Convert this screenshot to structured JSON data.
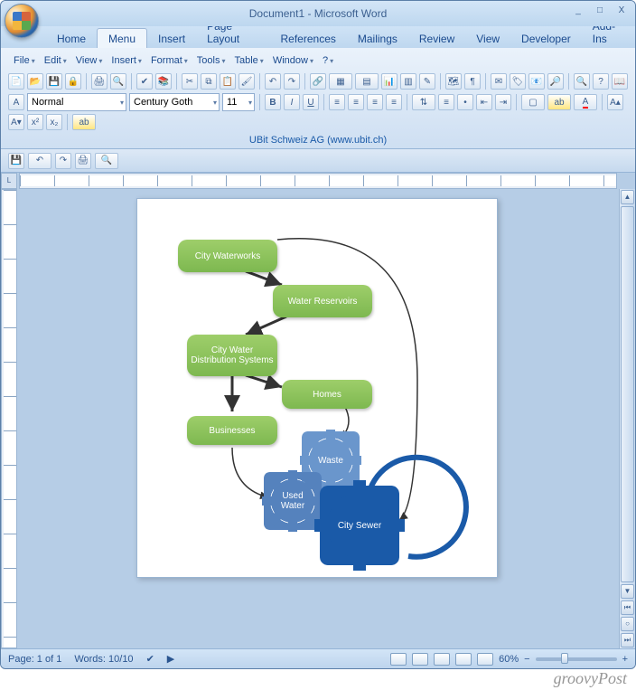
{
  "window": {
    "title": "Document1 - Microsoft Word",
    "min": "_",
    "max": "□",
    "close": "X"
  },
  "tabs": {
    "items": [
      "Home",
      "Menu",
      "Insert",
      "Page Layout",
      "References",
      "Mailings",
      "Review",
      "View",
      "Developer",
      "Add-Ins"
    ],
    "active_index": 1
  },
  "menubar": {
    "items": [
      "File",
      "Edit",
      "View",
      "Insert",
      "Format",
      "Tools",
      "Table",
      "Window",
      "?"
    ]
  },
  "style_combo": "Normal",
  "font_combo": "Century Goth",
  "size_combo": "11",
  "ribbon_footer": {
    "text": "UBit Schweiz AG (www.ubit.ch)"
  },
  "ruler_corner": "L",
  "flow": {
    "box1": "City Waterworks",
    "box2": "Water Reservoirs",
    "box3": "City Water Distribution Systems",
    "box4": "Homes",
    "box5": "Businesses",
    "gear1": "Waste",
    "gear2": "Used Water",
    "gear3": "City Sewer"
  },
  "status": {
    "page": "Page: 1 of 1",
    "words": "Words: 10/10",
    "zoom": "60%"
  },
  "watermark": "groovyPost"
}
